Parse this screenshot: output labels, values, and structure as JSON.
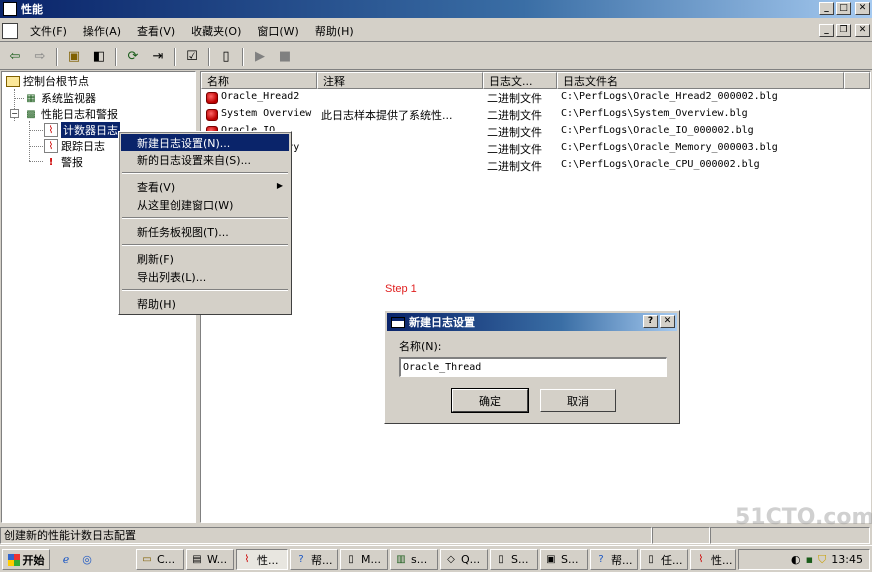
{
  "window": {
    "title": "性能"
  },
  "menubar": {
    "items": [
      "文件(F)",
      "操作(A)",
      "查看(V)",
      "收藏夹(O)",
      "窗口(W)",
      "帮助(H)"
    ]
  },
  "tree": {
    "root": "控制台根节点",
    "monitor": "系统监视器",
    "logs_alerts": "性能日志和警报",
    "counter_logs": "计数器日志",
    "trace_logs": "跟踪日志",
    "alerts": "警报"
  },
  "list": {
    "headers": [
      "名称",
      "注释",
      "日志文...",
      "日志文件名"
    ],
    "rows": [
      {
        "name": "Oracle_Hread2",
        "comment": "",
        "type": "二进制文件",
        "file": "C:\\PerfLogs\\Oracle_Hread2_000002.blg"
      },
      {
        "name": "System Overview",
        "comment": "此日志样本提供了系统性...",
        "type": "二进制文件",
        "file": "C:\\PerfLogs\\System_Overview.blg"
      },
      {
        "name": "Oracle_IO",
        "comment": "",
        "type": "二进制文件",
        "file": "C:\\PerfLogs\\Oracle_IO_000002.blg"
      },
      {
        "name": "Oracle_Memory",
        "comment": "",
        "type": "二进制文件",
        "file": "C:\\PerfLogs\\Oracle_Memory_000003.blg"
      },
      {
        "name": "Oracle_CPU",
        "comment": "",
        "type": "二进制文件",
        "file": "C:\\PerfLogs\\Oracle_CPU_000002.blg"
      }
    ]
  },
  "context_menu": {
    "new_log_settings": "新建日志设置(N)...",
    "new_from": "新的日志设置来自(S)...",
    "view": "查看(V)",
    "new_window": "从这里创建窗口(W)",
    "new_taskpad": "新任务板视图(T)...",
    "refresh": "刷新(F)",
    "export_list": "导出列表(L)...",
    "help": "帮助(H)"
  },
  "annotation": {
    "step": "Step 1"
  },
  "dialog": {
    "title": "新建日志设置",
    "help_btn": "?",
    "close_btn": "✕",
    "name_label": "名称(N):",
    "name_value": "Oracle_Thread",
    "ok": "确定",
    "cancel": "取消"
  },
  "statusbar": {
    "text": "创建新的性能计数日志配置"
  },
  "taskbar": {
    "start": "开始",
    "tasks": [
      "C...",
      "W...",
      "性...",
      "帮...",
      "M...",
      "s...",
      "Q...",
      "S...",
      "S...",
      "帮...",
      "任...",
      "性..."
    ],
    "clock": "13:45"
  },
  "icons": [
    "app-icon",
    "back-icon",
    "forward-icon",
    "up-folder-icon",
    "show-tree-icon",
    "refresh-icon",
    "export-icon",
    "properties-icon",
    "new-icon",
    "play-icon",
    "stop-icon",
    "log-icon"
  ]
}
